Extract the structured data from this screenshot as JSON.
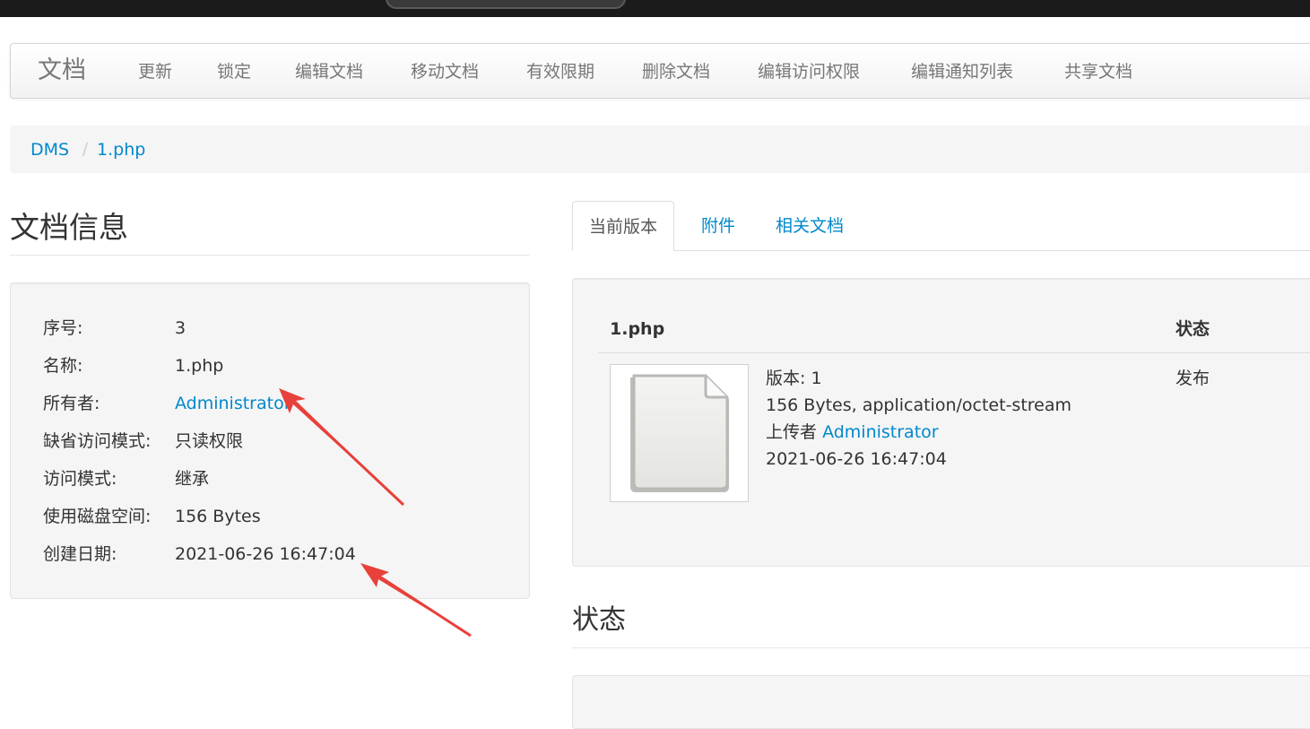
{
  "navbar": {
    "brand": "文档",
    "items": [
      "更新",
      "锁定",
      "编辑文档",
      "移动文档",
      "有效限期",
      "删除文档",
      "编辑访问权限",
      "编辑通知列表",
      "共享文档"
    ]
  },
  "breadcrumb": {
    "items": [
      "DMS",
      "1.php"
    ],
    "separator": "/"
  },
  "doc_info": {
    "title": "文档信息",
    "rows": [
      {
        "label": "序号:",
        "value": "3"
      },
      {
        "label": "名称:",
        "value": "1.php"
      },
      {
        "label": "所有者:",
        "value": "Administrator"
      },
      {
        "label": "缺省访问模式:",
        "value": "只读权限"
      },
      {
        "label": "访问模式:",
        "value": "继承"
      },
      {
        "label": "使用磁盘空间:",
        "value": "156 Bytes"
      },
      {
        "label": "创建日期:",
        "value": "2021-06-26 16:47:04"
      }
    ]
  },
  "tabs": [
    "当前版本",
    "附件",
    "相关文档"
  ],
  "version_table": {
    "headers": {
      "file": "1.php",
      "status": "状态"
    },
    "version_label": "版本: 1",
    "size_type": "156 Bytes, application/octet-stream",
    "uploader_label": "上传者",
    "uploader": "Administrator",
    "date": "2021-06-26 16:47:04",
    "status": "发布"
  },
  "status_section": {
    "title": "状态"
  },
  "colors": {
    "link": "#0088cc",
    "annotation": "#e8403a",
    "nav_text": "#777777"
  }
}
